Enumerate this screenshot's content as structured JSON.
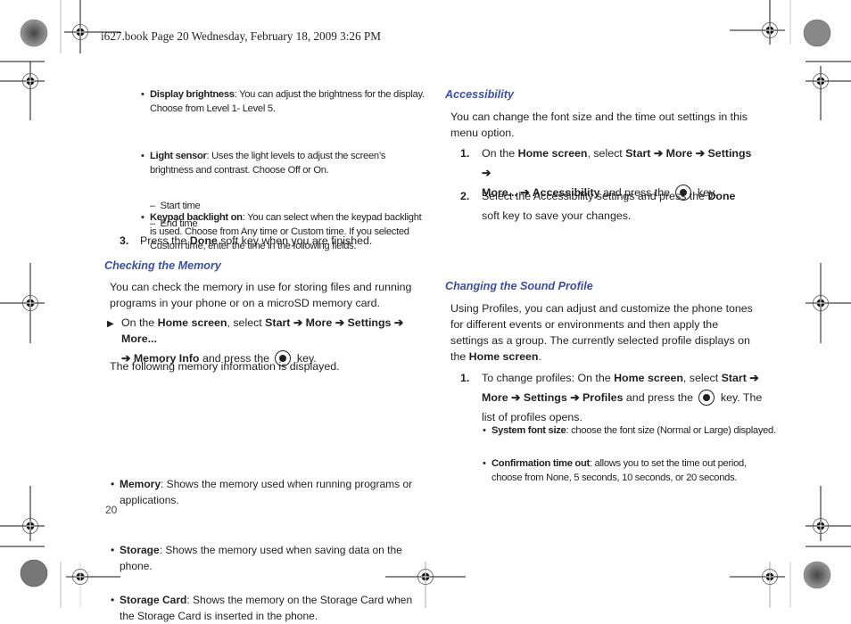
{
  "header": {
    "print_info": "i627.book  Page 20  Wednesday, February 18, 2009  3:26 PM"
  },
  "page_number": "20",
  "left_column": {
    "bullets_top": [
      {
        "term": "Display brightness",
        "text": ": You can adjust the brightness for the display. Choose from Level 1- Level 5."
      },
      {
        "term": "Light sensor",
        "text": ": Uses the light levels to adjust the screen’s brightness and contrast. Choose Off or On."
      },
      {
        "term": "Keypad backlight on",
        "text": ": You can select when the keypad backlight is used. Choose from Any time or Custom time. If you selected Custom time, enter the time in the following fields."
      }
    ],
    "sub_items": [
      "Start time",
      "End time"
    ],
    "step3": {
      "num": "3.",
      "pre": "Press the ",
      "bold": "Done",
      "post": " soft key when you are finished."
    },
    "section_memory": {
      "heading": "Checking the Memory",
      "intro": "You can check the memory in use for storing files and running programs in your phone or on a microSD memory card.",
      "step": {
        "pre": "On the ",
        "home": "Home screen",
        "mid": ", select ",
        "path": "Start ➔ More ➔ Settings ➔ More...",
        "path2": "➔ Memory Info",
        "and": " and press the ",
        "key": " key."
      },
      "following": "The following memory information is displayed.",
      "bullets": [
        {
          "term": "Memory",
          "text": ": Shows the memory used when running programs or applications."
        },
        {
          "term": "Storage",
          "text": ": Shows the memory used when saving data on the phone."
        },
        {
          "term": "Storage Card",
          "text": ": Shows the memory on the Storage Card when the Storage Card is inserted in the phone."
        }
      ]
    }
  },
  "right_column": {
    "section_accessibility": {
      "heading": "Accessibility",
      "intro": "You can change the font size and the time out settings in this menu option.",
      "step1": {
        "num": "1.",
        "pre": "On the ",
        "home": "Home screen",
        "mid": ", select ",
        "path": "Start ➔ More ➔ Settings ➔",
        "path2": "More... ➔ Accessibility",
        "and": " and press the ",
        "key": " key."
      },
      "step2": {
        "num": "2.",
        "pre": "Select the Accessibility settings and press the ",
        "bold": "Done",
        "post": " soft key to save your changes."
      },
      "bullets": [
        {
          "term": "System font size",
          "text": ": choose the font size (Normal or Large) displayed."
        },
        {
          "term": "Confirmation time out",
          "text": ": allows you to set the time out period, choose from None, 5 seconds, 10 seconds, or 20 seconds."
        }
      ]
    },
    "section_sound": {
      "heading": "Changing the Sound Profile",
      "intro_pre": "Using Profiles, you can adjust and customize the phone tones for different events or environments and then apply the settings as a group. The currently selected profile displays on the ",
      "intro_bold": "Home screen",
      "intro_post": ".",
      "step1": {
        "num": "1.",
        "pre": "To change profiles: On the ",
        "home": "Home screen",
        "mid": ", select ",
        "path": "Start ➔",
        "path2": "More ➔ Settings ➔ Profiles",
        "and": " and press the ",
        "key": " key. The list of profiles opens."
      }
    }
  },
  "colors": {
    "heading": "#3a4ea8",
    "text": "#231f20"
  }
}
